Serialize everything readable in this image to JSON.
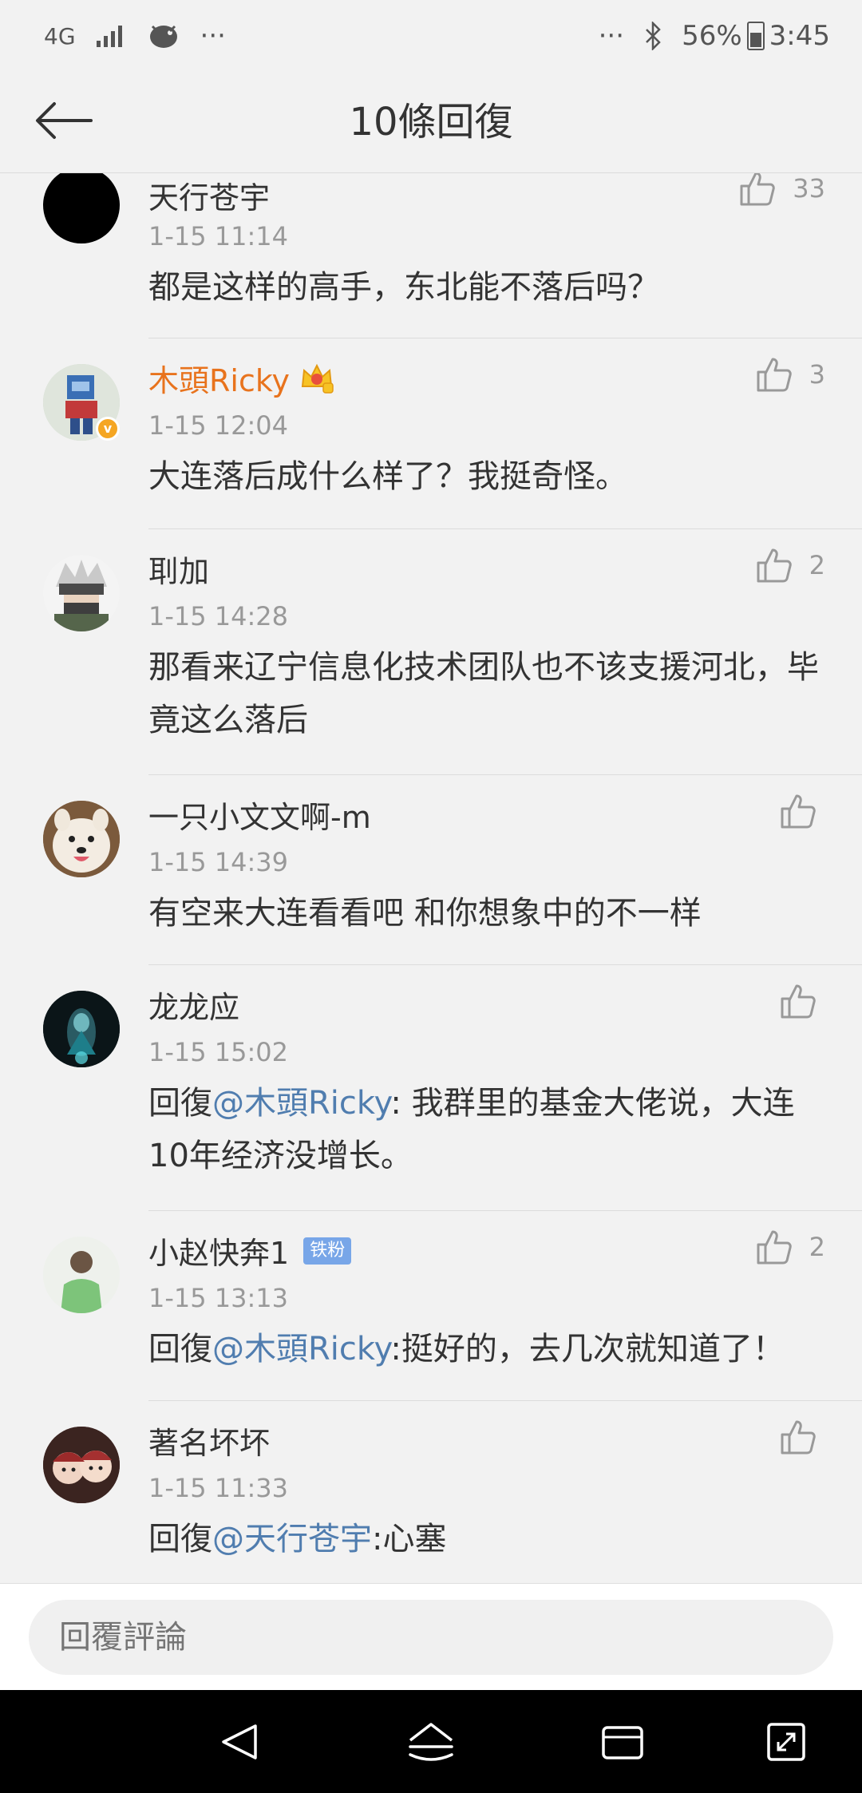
{
  "status_bar": {
    "network": "4G",
    "left_dots": "···",
    "right_dots": "···",
    "battery": "56%",
    "time": "3:45"
  },
  "header": {
    "title": "10條回復"
  },
  "comments": [
    {
      "name": "天行苍宇",
      "time": "1-15 11:14",
      "text": "都是这样的高手，东北能不落后吗？",
      "likes": "33"
    },
    {
      "name": "木頭Ricky",
      "time": "1-15 12:04",
      "text": "大连落后成什么样了？我挺奇怪。",
      "likes": "3"
    },
    {
      "name": "刵加",
      "time": "1-15 14:28",
      "text": "那看来辽宁信息化技术团队也不该支援河北，毕竟这么落后",
      "likes": "2"
    },
    {
      "name": "一只小文文啊-m",
      "time": "1-15 14:39",
      "text": "有空来大连看看吧 和你想象中的不一样",
      "likes": ""
    },
    {
      "name": "龙龙应",
      "time": "1-15 15:02",
      "reply_prefix": "回復",
      "mention": "@木頭Ricky",
      "text": ": 我群里的基金大佬说，大连10年经济没增长。",
      "likes": ""
    },
    {
      "name": "小赵快奔1",
      "badge": "铁粉",
      "time": "1-15 13:13",
      "reply_prefix": "回復",
      "mention": "@木頭Ricky",
      "text": ":挺好的，去几次就知道了！",
      "likes": "2"
    },
    {
      "name": "著名坏坏",
      "time": "1-15 11:33",
      "reply_prefix": "回復",
      "mention": "@天行苍宇",
      "text": ":心塞",
      "likes": ""
    }
  ],
  "reply_input": {
    "placeholder": "回覆評論"
  },
  "colors": {
    "background": "#f2f2f2",
    "mention": "#507daf",
    "vip_name": "#e8731d",
    "secondary_text": "#999999",
    "fan_badge": "#78a6e8"
  }
}
